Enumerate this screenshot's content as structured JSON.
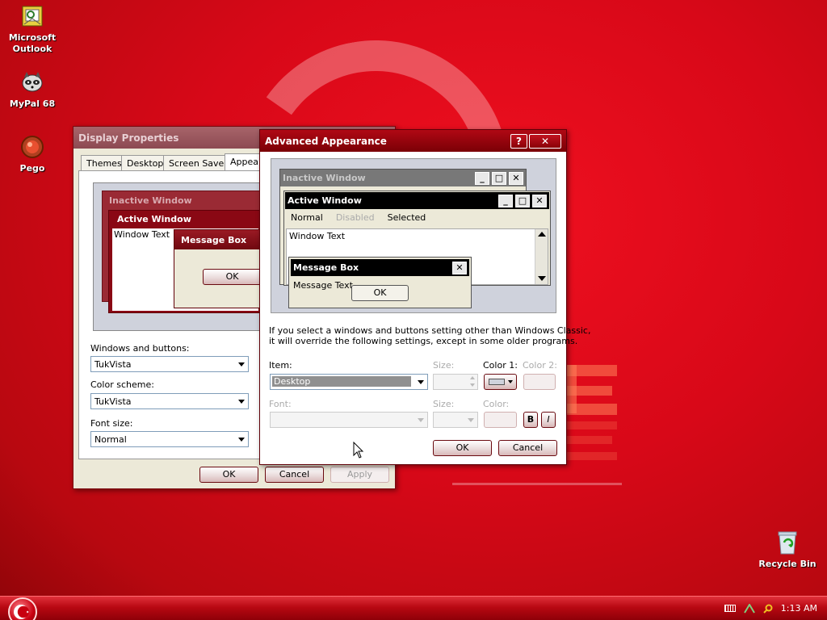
{
  "desktop_icons": [
    {
      "name": "outlook",
      "label_line1": "Microsoft",
      "label_line2": "Outlook"
    },
    {
      "name": "mypal",
      "label_line1": "MyPal 68",
      "label_line2": ""
    },
    {
      "name": "pego",
      "label_line1": "Pego",
      "label_line2": ""
    },
    {
      "name": "recycle",
      "label_line1": "Recycle Bin",
      "label_line2": ""
    }
  ],
  "display_properties": {
    "title": "Display Properties",
    "tabs": [
      "Themes",
      "Desktop",
      "Screen Saver",
      "Appearance"
    ],
    "preview": {
      "inactive_window": "Inactive Window",
      "active_window": "Active Window",
      "window_text": "Window Text",
      "message_box": "Message Box",
      "ok": "OK"
    },
    "windows_buttons_label": "Windows and buttons:",
    "windows_buttons_value": "TukVista",
    "color_scheme_label": "Color scheme:",
    "color_scheme_value": "TukVista",
    "font_size_label": "Font size:",
    "font_size_value": "Normal",
    "ok": "OK",
    "cancel": "Cancel",
    "apply": "Apply"
  },
  "advanced": {
    "title": "Advanced Appearance",
    "help_btn": "?",
    "close_btn": "✕",
    "preview": {
      "inactive_window": "Inactive Window",
      "active_window": "Active Window",
      "menu_normal": "Normal",
      "menu_disabled": "Disabled",
      "menu_selected": "Selected",
      "window_text": "Window Text",
      "message_box": "Message Box",
      "message_text": "Message Text",
      "ok": "OK"
    },
    "info_line1": "If you select a windows and buttons setting other than Windows Classic,",
    "info_line2": "it will override the following settings, except in some older programs.",
    "item_label": "Item:",
    "item_value": "Desktop",
    "size_label": "Size:",
    "color1_label": "Color 1:",
    "color2_label": "Color 2:",
    "font_label": "Font:",
    "font_size_label": "Size:",
    "font_color_label": "Color:",
    "bold": "B",
    "italic": "I",
    "ok": "OK",
    "cancel": "Cancel"
  },
  "taskbar": {
    "clock": "1:13 AM"
  },
  "colors": {
    "accent": "#c00010",
    "desktop": "#d80818"
  }
}
